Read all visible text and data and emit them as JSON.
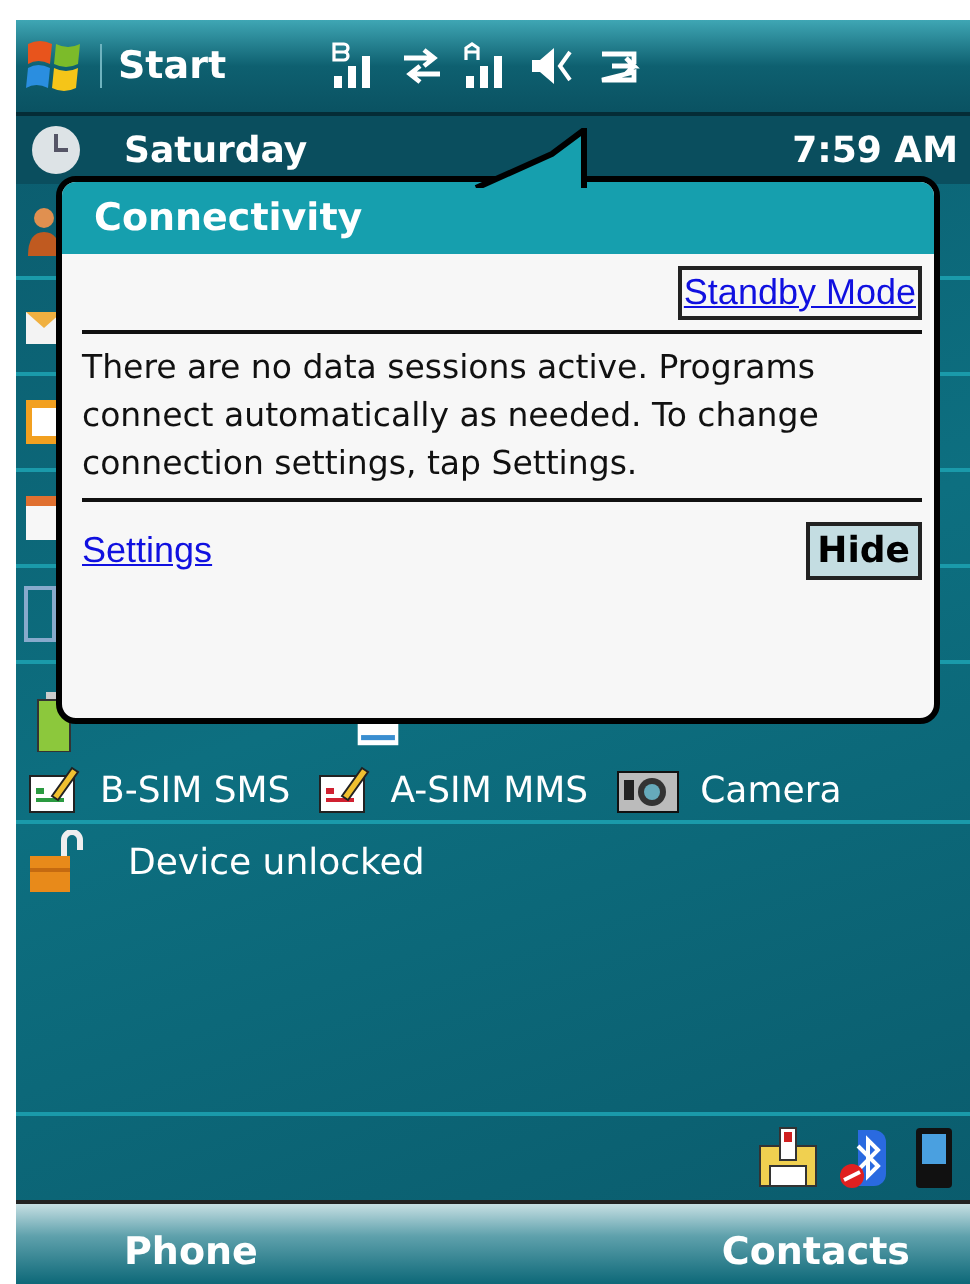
{
  "status_bar": {
    "start_label": "Start"
  },
  "today": {
    "date": "Saturday",
    "time": "7:59 AM",
    "shortcuts": [
      {
        "label": "B-SIM SMS"
      },
      {
        "label": "A-SIM MMS"
      },
      {
        "label": "Camera"
      }
    ],
    "lock_status": "Device unlocked"
  },
  "popup": {
    "title": "Connectivity",
    "top_link": "Standby Mode",
    "message": "There are no data sessions active. Programs connect automatically as needed. To change connection settings, tap Settings.",
    "bottom_link": "Settings",
    "button": "Hide"
  },
  "softkeys": [
    "Phone",
    "Contacts"
  ]
}
